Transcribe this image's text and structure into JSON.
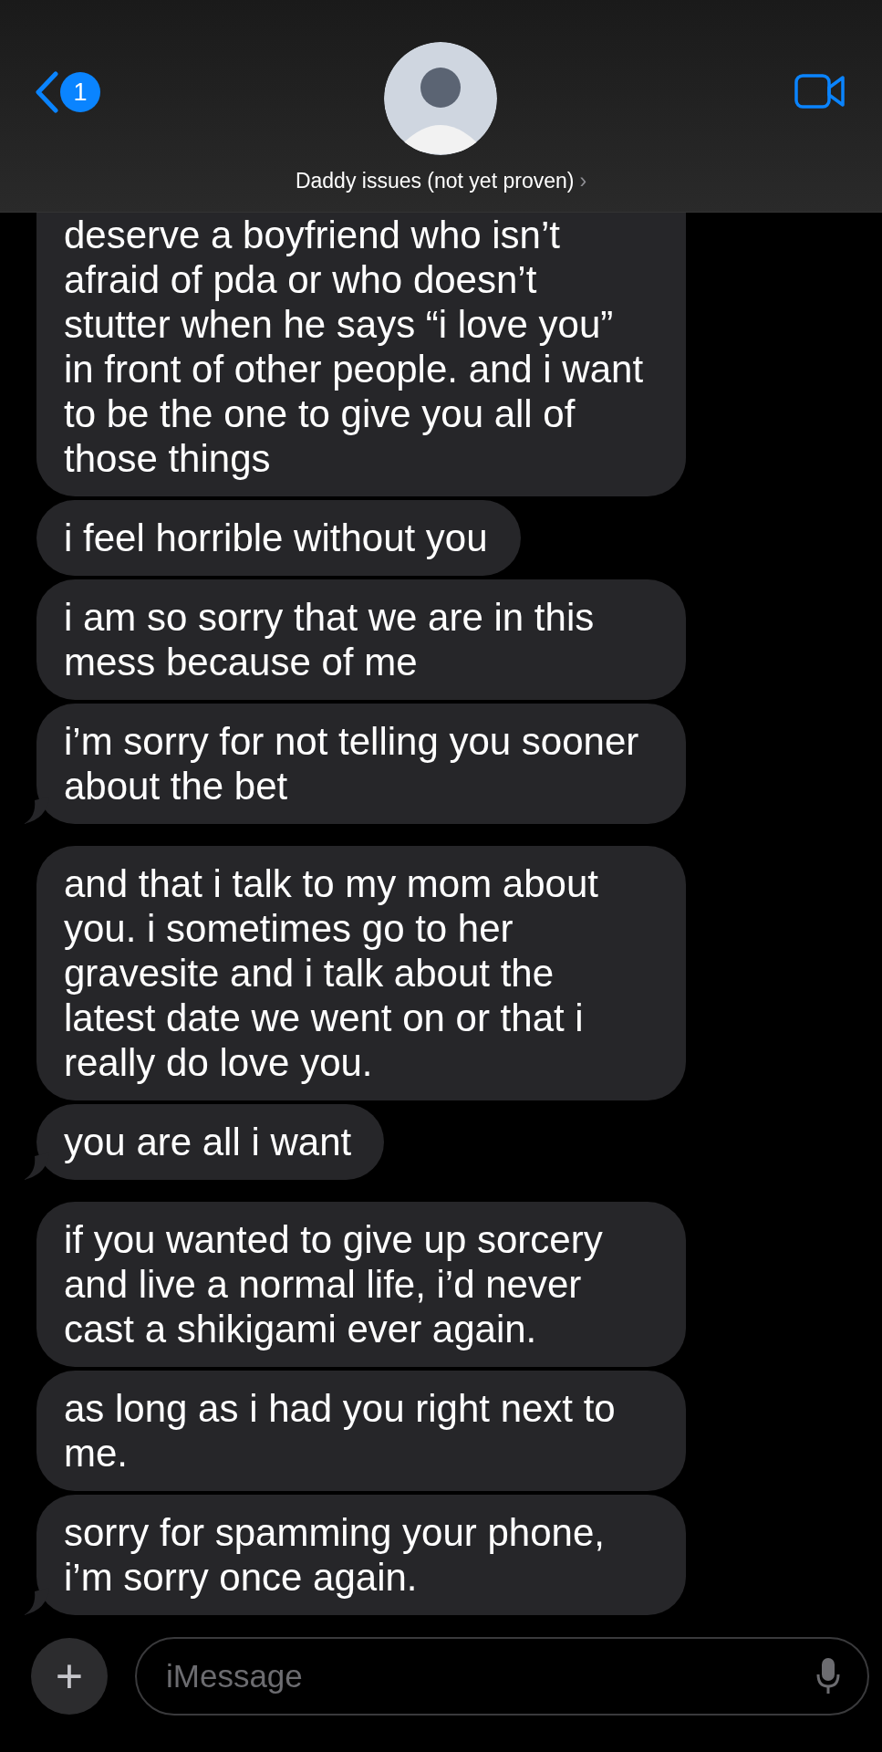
{
  "header": {
    "back_badge": "1",
    "contact_name": "Daddy issues (not yet proven)",
    "contact_chevron": "›"
  },
  "messages": [
    {
      "text": "deserve a boyfriend who isn’t afraid of pda or who doesn’t stutter when he says “i love you” in front of other people. and i want to be the one to give you all of those things",
      "tail": false,
      "cut_top": true
    },
    {
      "text": "i feel horrible without you",
      "tail": false,
      "cut_top": false
    },
    {
      "text": "i am so sorry that we are in this mess because of me",
      "tail": false,
      "cut_top": false
    },
    {
      "text": "i’m sorry for not telling you sooner about the bet",
      "tail": true,
      "cut_top": false
    },
    {
      "text": "and that i talk to my mom about you. i sometimes go to her gravesite and i talk about the latest date we went on or that i really do love you.",
      "tail": false,
      "cut_top": false
    },
    {
      "text": "you are all i want",
      "tail": true,
      "cut_top": false
    },
    {
      "text": "if you wanted to give up sorcery and live a normal life, i’d never cast a shikigami ever again.",
      "tail": false,
      "cut_top": false
    },
    {
      "text": "as long as i had you right next to me.",
      "tail": false,
      "cut_top": false
    },
    {
      "text": "sorry for spamming your phone, i’m sorry once again.",
      "tail": true,
      "cut_top": false
    }
  ],
  "composer": {
    "add_symbol": "+",
    "placeholder": "iMessage"
  }
}
